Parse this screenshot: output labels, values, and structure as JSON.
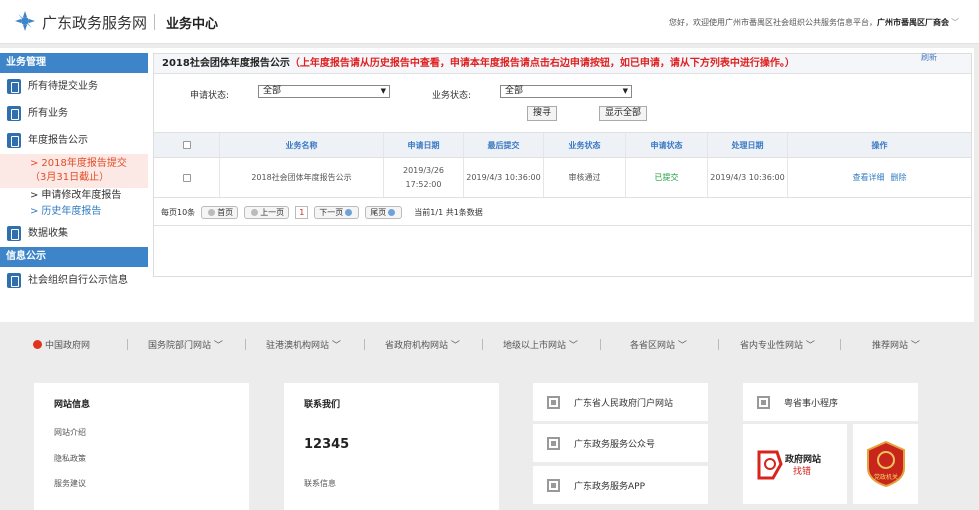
{
  "header": {
    "logo_text": "广东政务服务网",
    "center_title": "业务中心",
    "welcome_prefix": "您好，欢迎使用广州市番禺区社会组织公共服务信息平台，",
    "welcome_org": "广州市番禺区厂商会",
    "chevron": "﹀"
  },
  "sidebar": {
    "section1": "业务管理",
    "items": [
      "所有待提交业务",
      "所有业务",
      "年度报告公示"
    ],
    "sub_active_line1": "2018年度报告提交",
    "sub_active_line2": "（3月31日截止）",
    "sub_items": [
      "申请修改年度报告",
      "历史年度报告"
    ],
    "item_data": "数据收集",
    "section2": "信息公示",
    "item_info": "社会组织自行公示信息",
    "arrow": ">"
  },
  "panel": {
    "title_main": "2018社会团体年度报告公示",
    "title_note": "（上年度报告请从历史报告中查看，申请本年度报告请点击右边申请按钮，如已申请，请从下方列表中进行操作。）",
    "refresh": "刷新",
    "filter1_label": "申请状态:",
    "filter1_value": "全部",
    "filter2_label": "业务状态:",
    "filter2_value": "全部",
    "search_btn": "搜寻",
    "show_all_btn": "显示全部"
  },
  "table": {
    "headers": [
      "业务名称",
      "申请日期",
      "最后提交",
      "业务状态",
      "申请状态",
      "处理日期",
      "操作"
    ],
    "row": {
      "name": "2018社会团体年度报告公示",
      "apply_date_1": "2019/3/26",
      "apply_date_2": "17:52:00",
      "last_submit": "2019/4/3 10:36:00",
      "biz_status": "审核通过",
      "apply_status": "已提交",
      "process_date": "2019/4/3 10:36:00",
      "action_view": "查看详细",
      "action_delete": "删除"
    }
  },
  "pager": {
    "per_page": "每页10条",
    "first": "首页",
    "prev": "上一页",
    "current": "1",
    "next": "下一页",
    "last": "尾页",
    "info": "当前1/1 共1条数据"
  },
  "footer_nav": [
    "中国政府网",
    "国务院部门网站",
    "驻港澳机构网站",
    "省政府机构网站",
    "地级以上市网站",
    "各省区网站",
    "省内专业性网站",
    "推荐网站"
  ],
  "footer": {
    "site_info_title": "网站信息",
    "site_info_links": [
      "网站介绍",
      "隐私政策",
      "服务建议"
    ],
    "contact_title": "联系我们",
    "contact_phone": "12345",
    "contact_info": "联系信息",
    "qr_items": [
      "广东省人民政府门户网站",
      "广东政务服务公众号",
      "广东政务服务APP"
    ],
    "mini_program": "粤省事小程序",
    "badge1_line1": "政府网站",
    "badge1_line2": "找错",
    "badge2_text": "党政机关"
  },
  "colors": {
    "accent_blue": "#3d84c8",
    "red_note": "#e02020",
    "active_orange": "#e24c26",
    "green_status": "#1a9d3c"
  }
}
